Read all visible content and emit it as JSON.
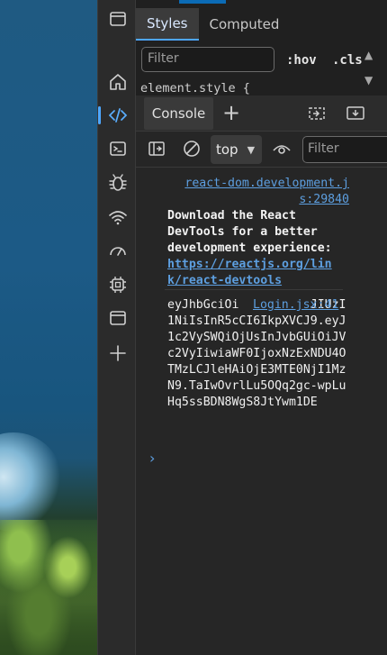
{
  "styles_tabs": [
    "Styles",
    "Computed"
  ],
  "styles_filter_placeholder": "Filter",
  "hov_label": ":hov",
  "cls_label": ".cls",
  "element_style": "element.style {",
  "drawer": {
    "console_tab": "Console",
    "context_selector": "top",
    "console_filter_placeholder": "Filter"
  },
  "messages": [
    {
      "source": "react-dom.development.js:29840",
      "source_line1": "react-dom.development.j",
      "source_line2": "s:29840",
      "text_lines": [
        "Download the React",
        "DevTools for a better",
        "development experience:"
      ],
      "link_line1": "https://reactjs.org/lin",
      "link_line2": "k/react-devtools"
    },
    {
      "source": "Login.jsx:41",
      "text": "eyJhbGciOi          JIUzI1NiIsInR5cCI6IkpXVCJ9.eyJ1c2VySWQiOjUsInJvbGUiOiJVc2VyIiwiaWF0IjoxNzExNDU4OTMzLCJleHAiOjE3MTE0NjI1MzN9.TaIwOvrlLu5OQq2gc-wpLuHq5ssBDN8WgS8JtYwm1DE"
    }
  ],
  "prompt_symbol": "›",
  "activity_icons": [
    "window-icon",
    "home-icon",
    "elements-icon",
    "console-icon",
    "bug-icon",
    "network-icon",
    "performance-icon",
    "cpu-icon",
    "application-icon",
    "add-icon"
  ],
  "colors": {
    "accent": "#4ea7ff",
    "link": "#5d9fe0",
    "panel": "#262626"
  }
}
